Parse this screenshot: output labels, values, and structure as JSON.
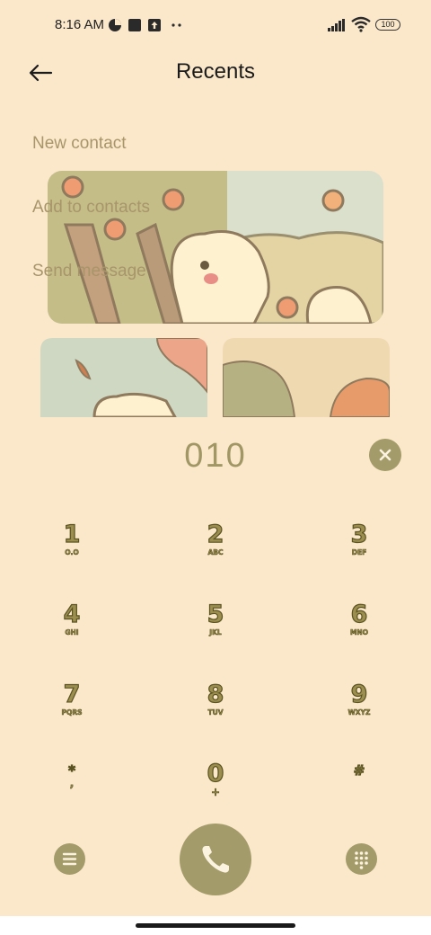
{
  "status_bar": {
    "time": "8:16 AM",
    "battery": "100"
  },
  "header": {
    "title": "Recents"
  },
  "menu": {
    "new_contact": "New contact",
    "add_to_contacts": "Add to contacts",
    "send_message": "Send message"
  },
  "dialer": {
    "number": "010"
  },
  "keypad": [
    {
      "digit": "1",
      "letters": "O.O"
    },
    {
      "digit": "2",
      "letters": "ABC"
    },
    {
      "digit": "3",
      "letters": "DEF"
    },
    {
      "digit": "4",
      "letters": "GHI"
    },
    {
      "digit": "5",
      "letters": "JKL"
    },
    {
      "digit": "6",
      "letters": "MNO"
    },
    {
      "digit": "7",
      "letters": "PQRS"
    },
    {
      "digit": "8",
      "letters": "TUV"
    },
    {
      "digit": "9",
      "letters": "WXYZ"
    },
    {
      "digit": "*",
      "letters": ","
    },
    {
      "digit": "0",
      "letters": "+"
    },
    {
      "digit": "#",
      "letters": ""
    }
  ],
  "colors": {
    "background": "#fbe8cb",
    "accent": "#a39b6a",
    "digit": "#9b8e4f",
    "menu_text": "#a8956a"
  },
  "icons": [
    "back-arrow-icon",
    "clear-icon",
    "menu-icon",
    "phone-icon",
    "dialpad-icon"
  ]
}
